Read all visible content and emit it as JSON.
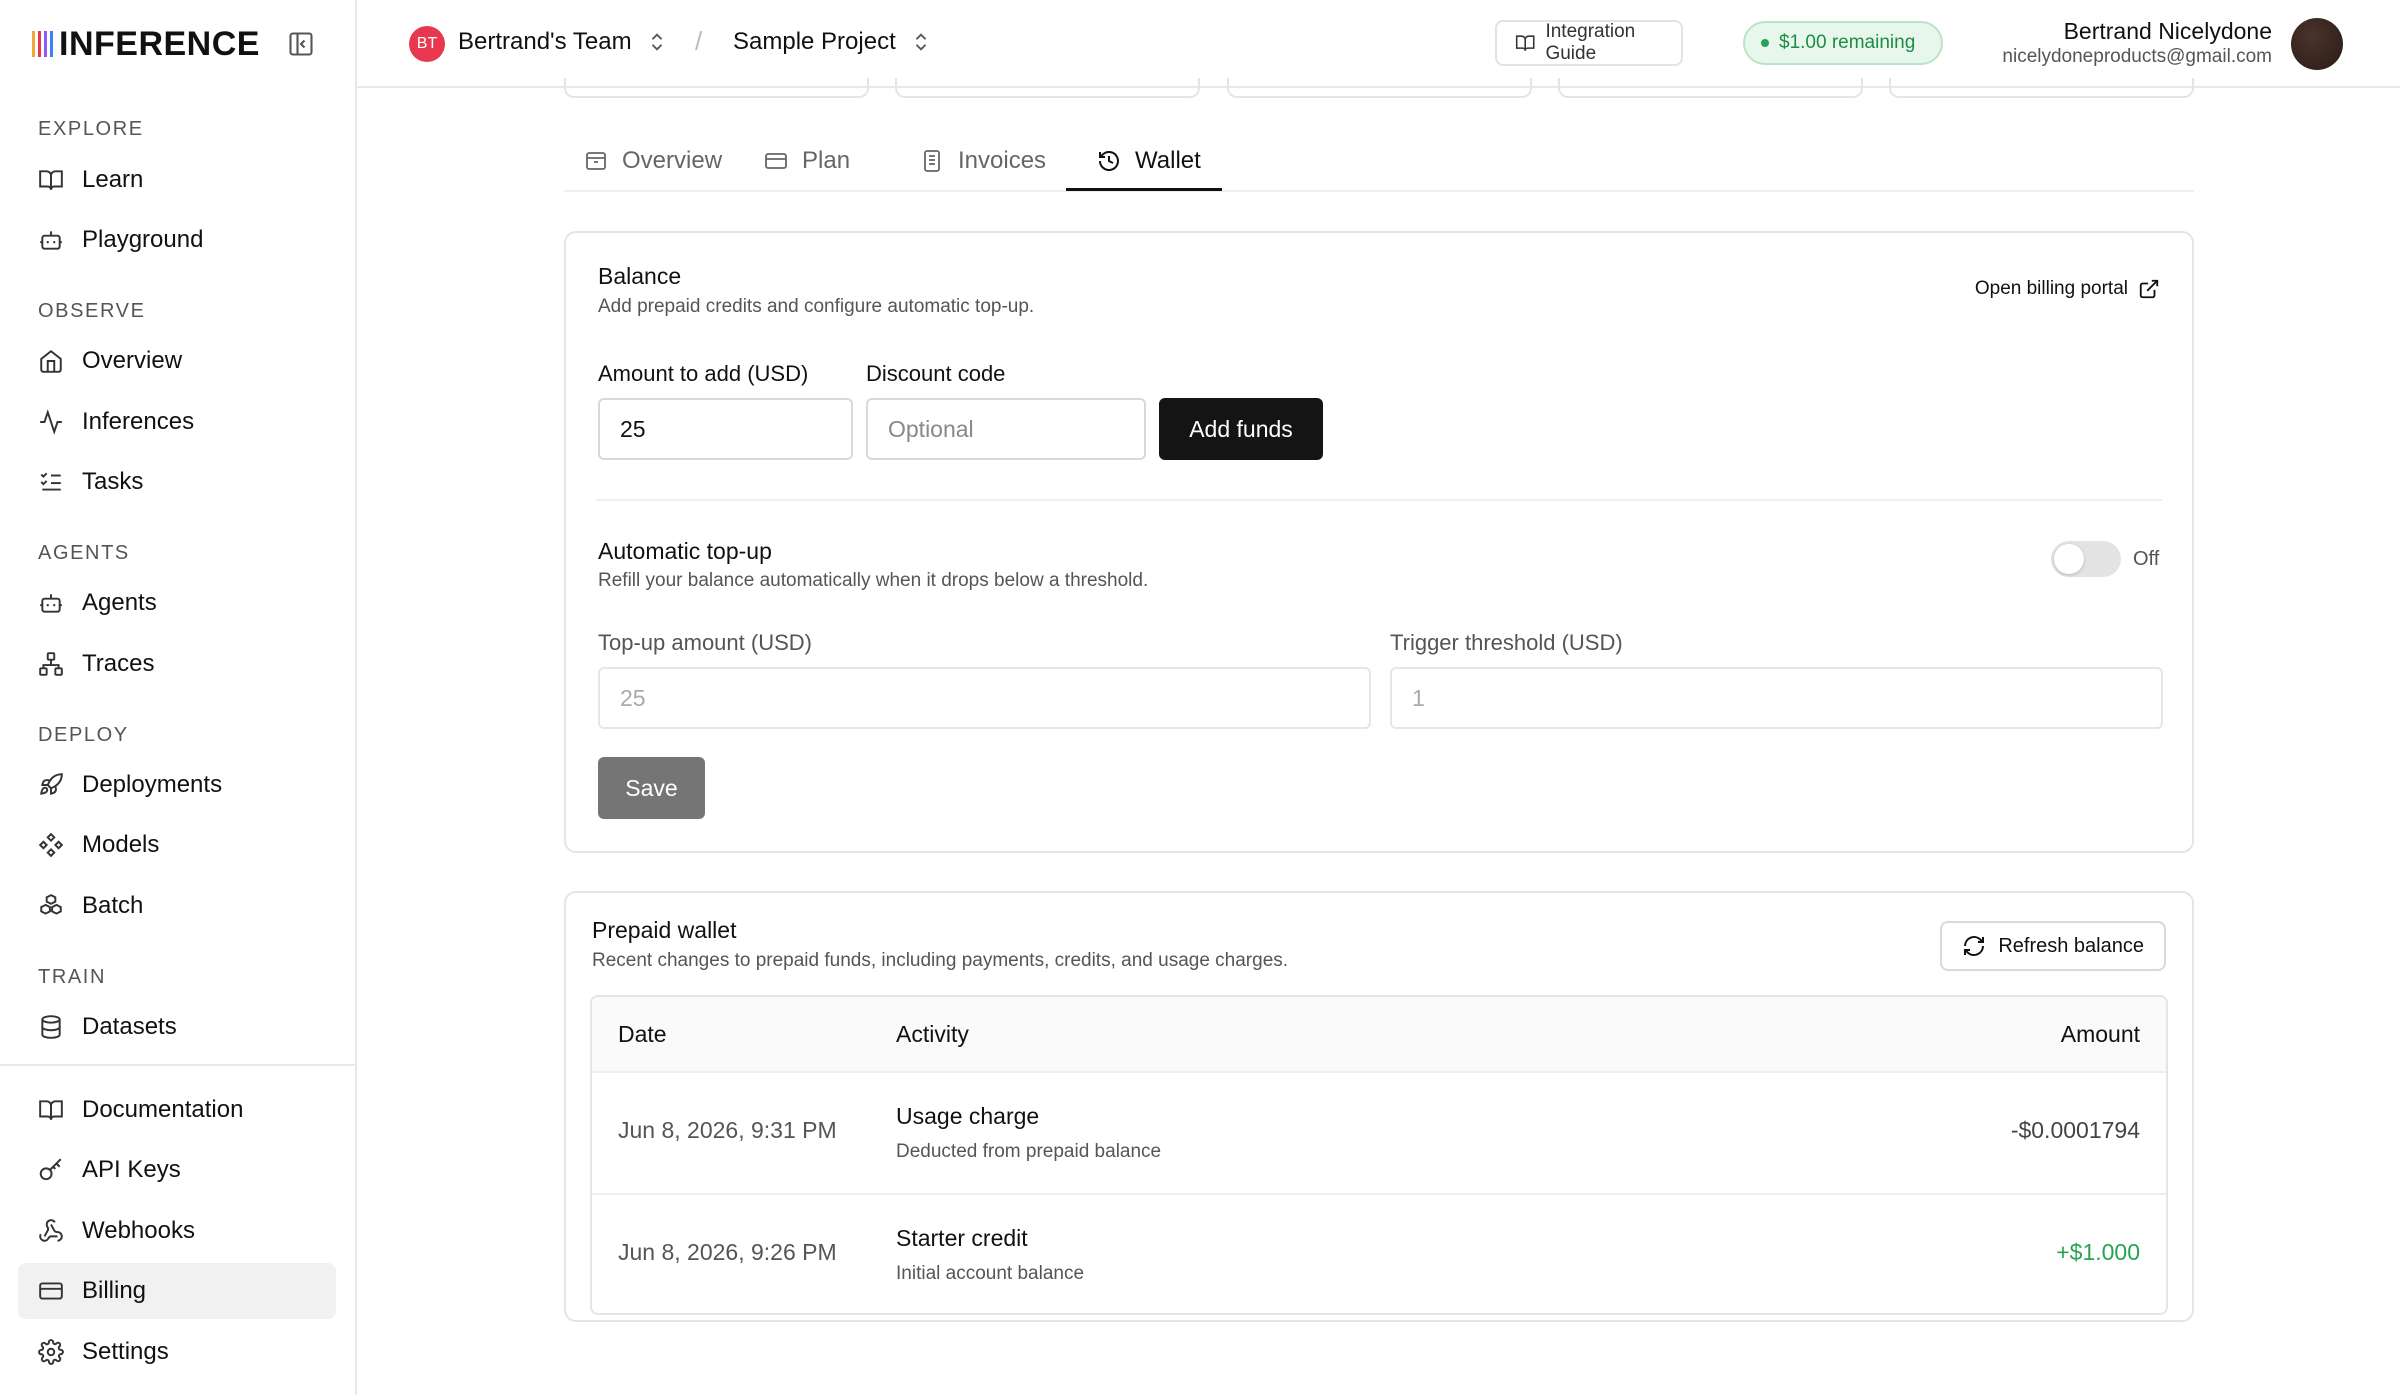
{
  "brand": {
    "logo_text": "INFERENCE",
    "logo_bar_colors": [
      "#f2a93b",
      "#e8384f",
      "#8b5cf6",
      "#3b82f6"
    ]
  },
  "sidebar": {
    "sections": {
      "explore": "EXPLORE",
      "observe": "OBSERVE",
      "agents": "AGENTS",
      "deploy": "DEPLOY",
      "train": "TRAIN"
    },
    "items": {
      "learn": "Learn",
      "playground": "Playground",
      "overview": "Overview",
      "inferences": "Inferences",
      "tasks": "Tasks",
      "agents": "Agents",
      "traces": "Traces",
      "deployments": "Deployments",
      "models": "Models",
      "batch": "Batch",
      "datasets": "Datasets",
      "documentation": "Documentation",
      "api_keys": "API Keys",
      "webhooks": "Webhooks",
      "billing": "Billing",
      "settings": "Settings"
    },
    "active_item": "Billing"
  },
  "topbar": {
    "team_initials": "BT",
    "team_name": "Bertrand's Team",
    "separator": "/",
    "project_name": "Sample Project",
    "integration_guide": "Integration Guide",
    "remaining": "$1.00 remaining",
    "user_name": "Bertrand Nicelydone",
    "user_email": "nicelydoneproducts@gmail.com"
  },
  "tabs": [
    {
      "label": "Overview",
      "active": false
    },
    {
      "label": "Plan",
      "active": false
    },
    {
      "label": "Invoices",
      "active": false
    },
    {
      "label": "Wallet",
      "active": true
    }
  ],
  "balance": {
    "title": "Balance",
    "subtitle": "Add prepaid credits and configure automatic top-up.",
    "billing_portal": "Open billing portal",
    "amount_label": "Amount to add (USD)",
    "amount_value": "25",
    "discount_label": "Discount code",
    "discount_placeholder": "Optional",
    "add_funds": "Add funds",
    "auto_title": "Automatic top-up",
    "auto_subtitle": "Refill your balance automatically when it drops below a threshold.",
    "auto_state": "Off",
    "topup_label": "Top-up amount (USD)",
    "topup_placeholder": "25",
    "threshold_label": "Trigger threshold (USD)",
    "threshold_placeholder": "1",
    "save": "Save"
  },
  "wallet": {
    "title": "Prepaid wallet",
    "subtitle": "Recent changes to prepaid funds, including payments, credits, and usage charges.",
    "refresh": "Refresh balance",
    "columns": {
      "date": "Date",
      "activity": "Activity",
      "amount": "Amount"
    },
    "rows": [
      {
        "date": "Jun 8, 2026, 9:31 PM",
        "activity": "Usage charge",
        "detail": "Deducted from prepaid balance",
        "amount": "-$0.0001794",
        "amount_color": "#444444"
      },
      {
        "date": "Jun 8, 2026, 9:26 PM",
        "activity": "Starter credit",
        "detail": "Initial account balance",
        "amount": "+$1.000",
        "amount_color": "#27a354"
      }
    ]
  }
}
